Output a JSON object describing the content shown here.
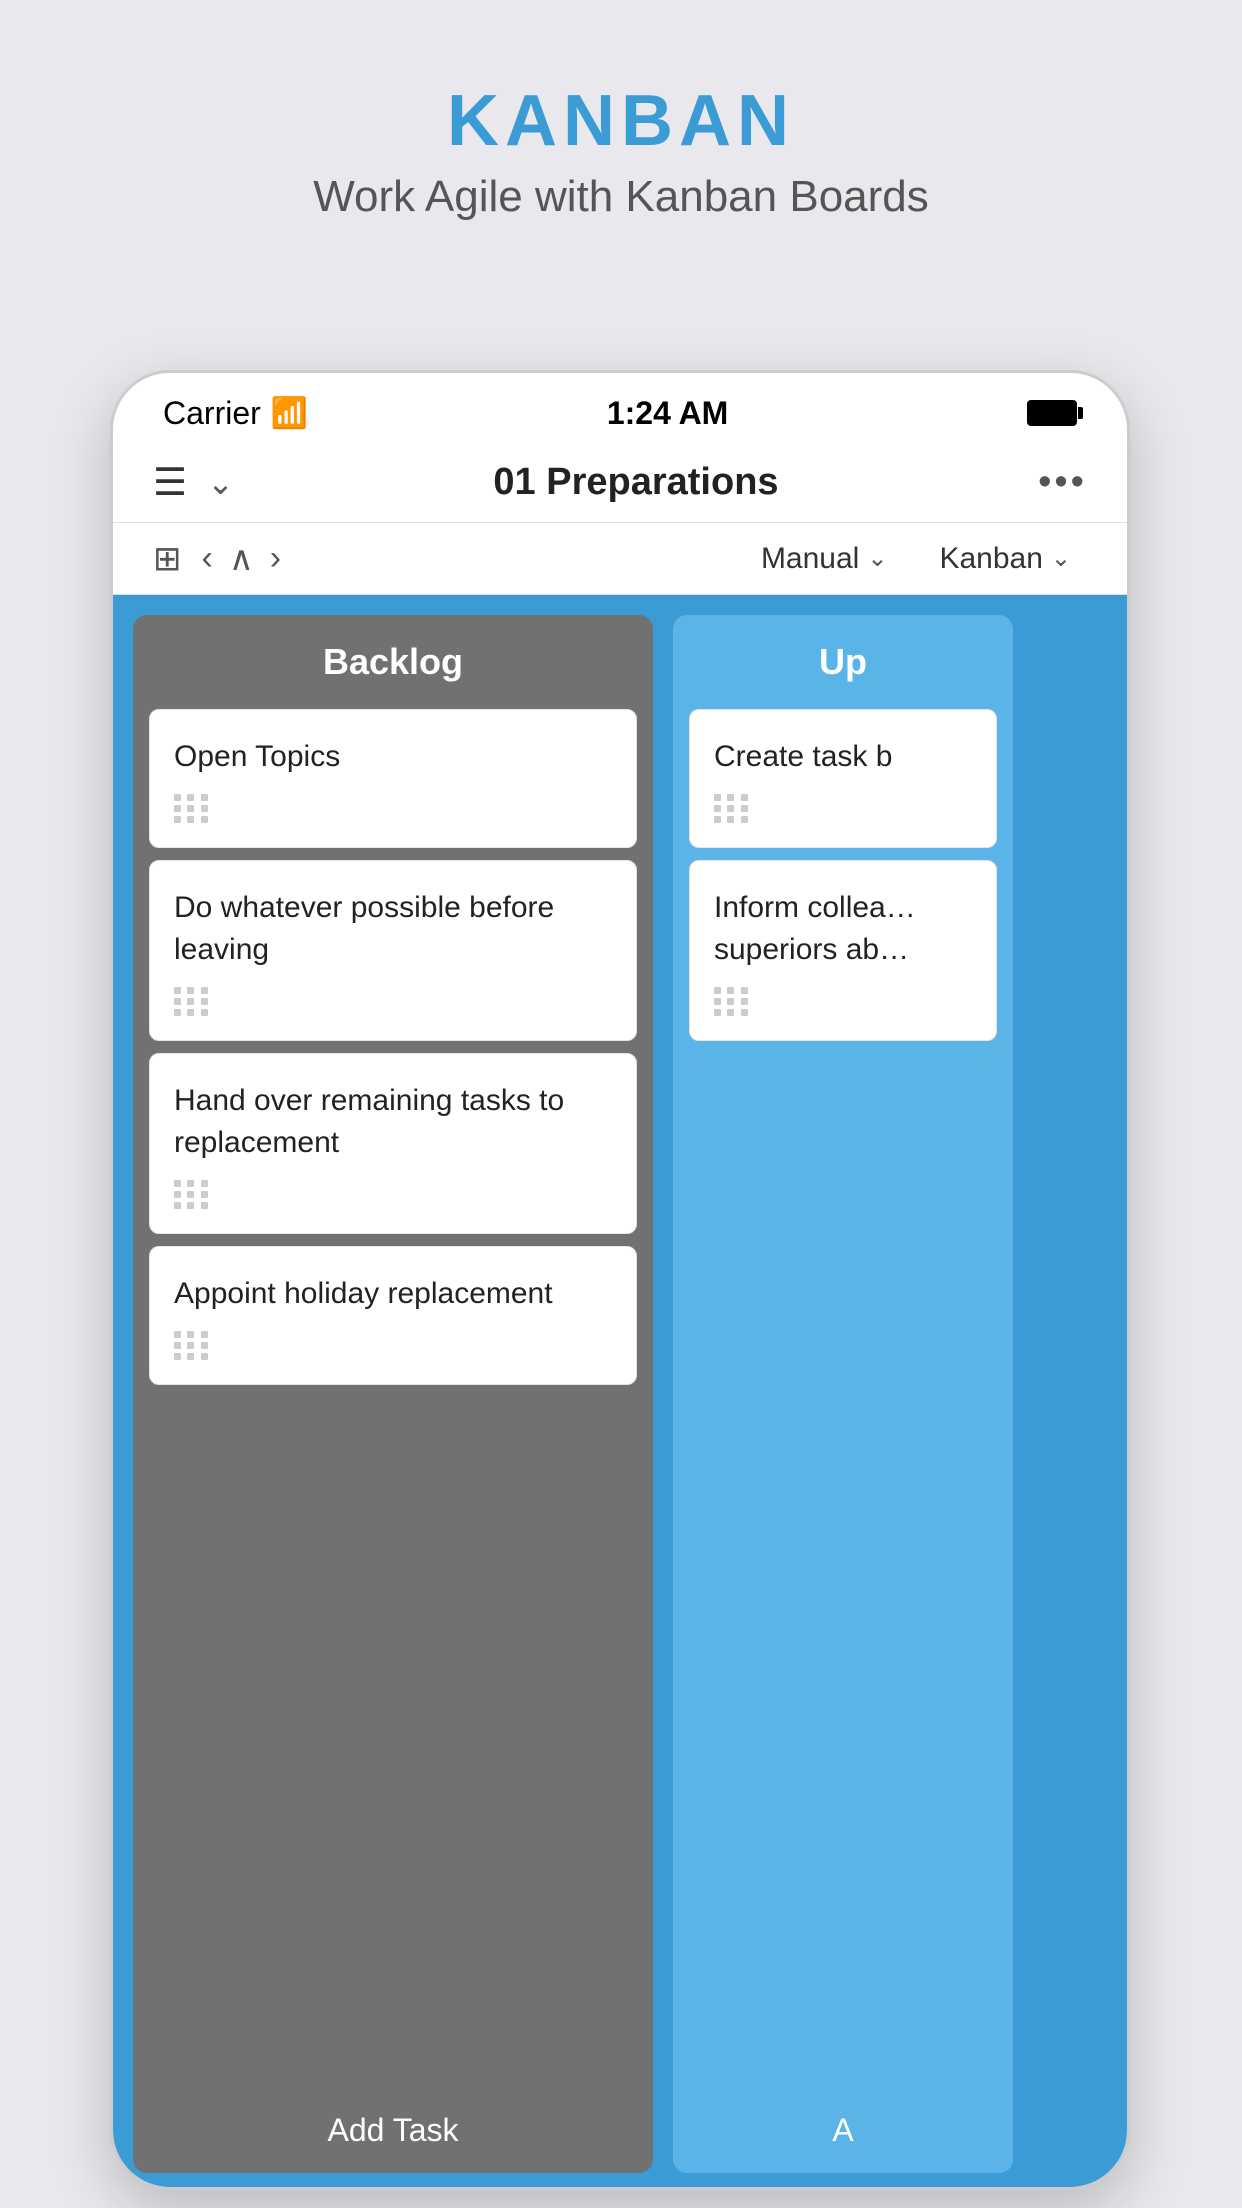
{
  "app": {
    "title": "KANBAN",
    "subtitle": "Work Agile with Kanban Boards"
  },
  "status_bar": {
    "carrier": "Carrier",
    "time": "1:24 AM"
  },
  "nav": {
    "title": "01  Preparations",
    "dots": "•••"
  },
  "toolbar": {
    "manual_label": "Manual",
    "kanban_label": "Kanban"
  },
  "board": {
    "columns": [
      {
        "id": "backlog",
        "header": "Backlog",
        "cards": [
          {
            "id": "card1",
            "title": "Open Topics"
          },
          {
            "id": "card2",
            "title": "Do whatever possible before leaving"
          },
          {
            "id": "card3",
            "title": "Hand over remaining tasks to replacement"
          },
          {
            "id": "card4",
            "title": "Appoint holiday replacement"
          }
        ],
        "add_btn": "Add Task"
      },
      {
        "id": "upcoming",
        "header": "Up",
        "cards": [
          {
            "id": "card5",
            "title": "Create task b"
          },
          {
            "id": "card6",
            "title": "Inform collea… superiors ab…"
          }
        ],
        "add_btn": "A"
      }
    ]
  },
  "colors": {
    "brand_blue": "#3a9bd5",
    "backlog_col": "#717171",
    "upcoming_col": "#5ab4e8",
    "card_bg": "#ffffff"
  }
}
